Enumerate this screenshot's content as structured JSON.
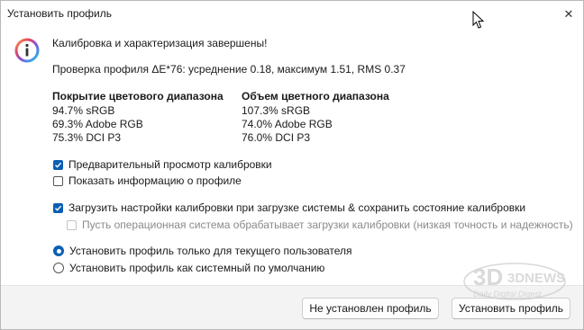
{
  "window": {
    "title": "Установить профиль",
    "close_symbol": "✕"
  },
  "info_icon": "info-icon",
  "main": {
    "heading": "Калибровка и характеризация завершены!",
    "verification": "Проверка профиля ΔE*76: усреднение 0.18, максимум 1.51, RMS 0.37",
    "coverage": {
      "title": "Покрытие цветового диапазона",
      "lines": [
        "94.7% sRGB",
        "69.3% Adobe RGB",
        "75.3% DCI P3"
      ]
    },
    "volume": {
      "title": "Объем цветного диапазона",
      "lines": [
        "107.3% sRGB",
        "74.0% Adobe RGB",
        "76.0% DCI P3"
      ]
    },
    "checkboxes": {
      "preview": {
        "label": "Предварительный просмотр калибровки",
        "checked": true
      },
      "show_info": {
        "label": "Показать информацию о профиле",
        "checked": false
      },
      "load_on_startup": {
        "label": "Загрузить настройки калибровки при загрузке системы & сохранить состояние калибровки",
        "checked": true
      },
      "os_loader": {
        "label": "Пусть операционная система обрабатывает загрузки калибровки (низкая точность и надежность)",
        "checked": false,
        "disabled": true
      }
    },
    "radios": {
      "current_user": {
        "label": "Установить профиль только для текущего пользователя",
        "selected": true
      },
      "system_default": {
        "label": "Установить профиль как системный по умолчанию",
        "selected": false
      }
    }
  },
  "footer": {
    "dont_install_label": "Не установлен профиль",
    "install_label": "Установить профиль"
  },
  "watermark": {
    "brand": "3DNEWS",
    "tagline": "Daily Digital Digest"
  },
  "colors": {
    "accent": "#0a5fb4",
    "footer_bg": "#f3f3f3"
  }
}
